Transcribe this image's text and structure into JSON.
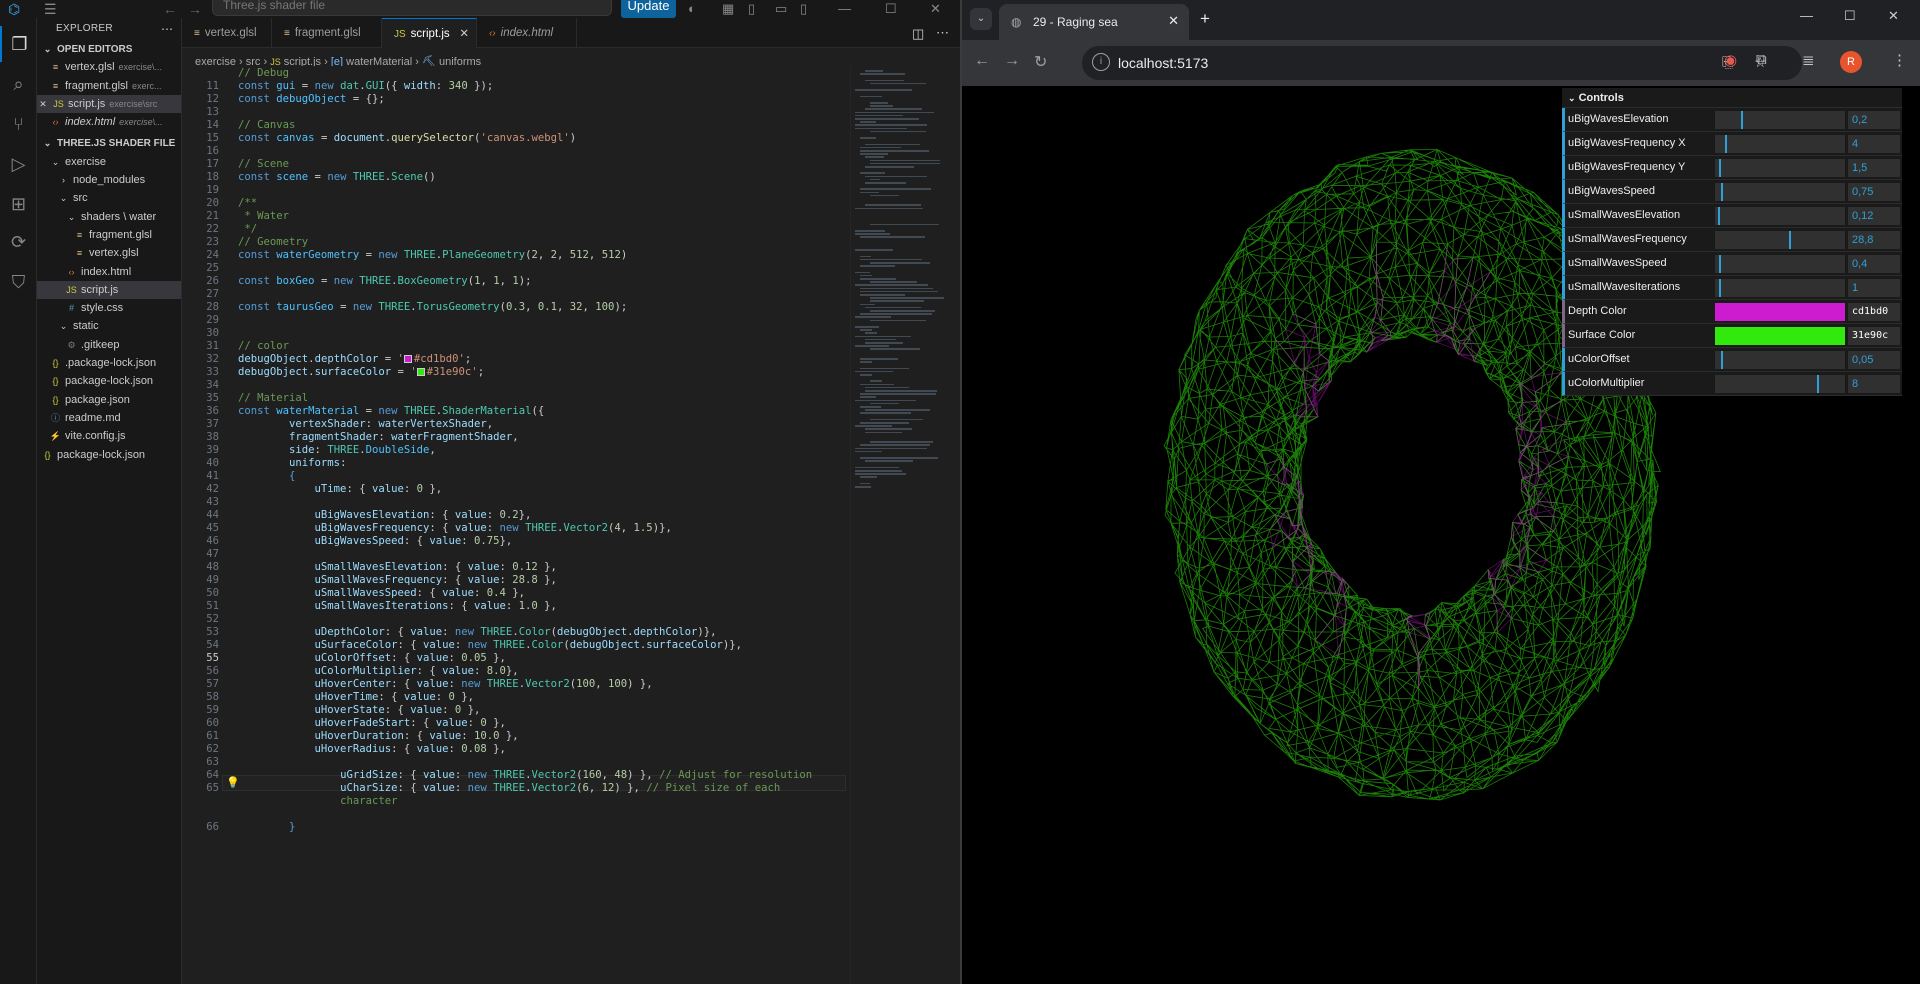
{
  "vscode": {
    "search_placeholder": "Three.js shader file",
    "update_label": "Update",
    "explorer_title": "EXPLORER",
    "open_editors_title": "OPEN EDITORS",
    "open_editors": [
      {
        "name": "vertex.glsl",
        "sub": "exercise\\..."
      },
      {
        "name": "fragment.glsl",
        "sub": "exerc..."
      },
      {
        "name": "script.js",
        "sub": "exercise\\src"
      },
      {
        "name": "index.html",
        "sub": "exercise\\..."
      }
    ],
    "project_title": "THREE.JS SHADER FILE",
    "tree": [
      "exercise",
      "node_modules",
      "src",
      "shaders \\ water",
      "fragment.glsl",
      "vertex.glsl",
      "index.html",
      "script.js",
      "style.css",
      "static",
      ".gitkeep",
      ".package-lock.json",
      "package-lock.json",
      "package.json",
      "readme.md",
      "vite.config.js",
      "package-lock.json"
    ],
    "tabs": [
      "vertex.glsl",
      "fragment.glsl",
      "script.js",
      "index.html"
    ],
    "breadcrumb": [
      "exercise",
      "src",
      "script.js",
      "waterMaterial",
      "uniforms"
    ]
  },
  "browser": {
    "tab_title": "29 - Raging sea",
    "url": "localhost:5173",
    "avatar": "R"
  },
  "gui": {
    "title": "Controls",
    "rows": [
      {
        "label": "uBigWavesElevation",
        "value": "0,2",
        "frac": 0.2
      },
      {
        "label": "uBigWavesFrequency X",
        "value": "4",
        "frac": 0.08
      },
      {
        "label": "uBigWavesFrequency Y",
        "value": "1,5",
        "frac": 0.03
      },
      {
        "label": "uBigWavesSpeed",
        "value": "0,75",
        "frac": 0.05
      },
      {
        "label": "uSmallWavesElevation",
        "value": "0,12",
        "frac": 0.02
      },
      {
        "label": "uSmallWavesFrequency",
        "value": "28,8",
        "frac": 0.58
      },
      {
        "label": "uSmallWavesSpeed",
        "value": "0,4",
        "frac": 0.03
      },
      {
        "label": "uSmallWavesIterations",
        "value": "1",
        "frac": 0.03
      },
      {
        "label": "Depth Color",
        "value": "cd1bd0",
        "color": "#cd1bd0"
      },
      {
        "label": "Surface Color",
        "value": "31e90c",
        "color": "#31e90c"
      },
      {
        "label": "uColorOffset",
        "value": "0,05",
        "frac": 0.05
      },
      {
        "label": "uColorMultiplier",
        "value": "8",
        "frac": 0.8
      }
    ]
  },
  "code": {
    "line_numbers": [
      "11",
      "12",
      "13",
      "14",
      "15",
      "16",
      "17",
      "18",
      "19",
      "20",
      "21",
      "22",
      "23",
      "24",
      "25",
      "26",
      "27",
      "28",
      "29",
      "30",
      "31",
      "32",
      "33",
      "34",
      "35",
      "36",
      "37",
      "38",
      "39",
      "40",
      "41",
      "42",
      "43",
      "44",
      "45",
      "46",
      "47",
      "48",
      "49",
      "50",
      "51",
      "52",
      "53",
      "54",
      "55",
      "56",
      "57",
      "58",
      "59",
      "60",
      "61",
      "62",
      "63",
      "64",
      "65",
      "66"
    ],
    "current_line": "55",
    "strings": {
      "depth": "#cd1bd0",
      "surface": "#31e90c"
    }
  },
  "colors": {
    "accent": "#0078d4",
    "gui_number": "#2fa1d6",
    "depth": "#cd1bd0",
    "surface": "#31e90c"
  }
}
